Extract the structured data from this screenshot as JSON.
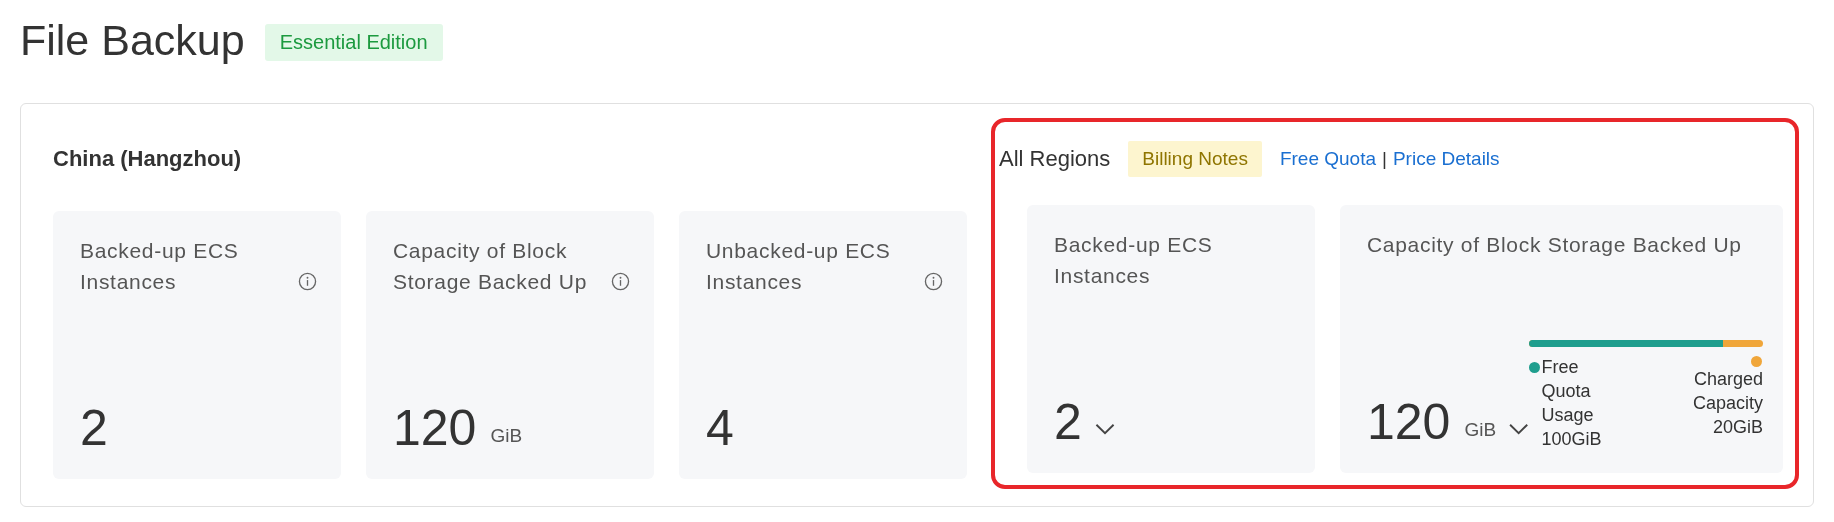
{
  "page": {
    "title": "File Backup",
    "edition_badge": "Essential Edition"
  },
  "regional": {
    "heading": "China (Hangzhou)",
    "cards": [
      {
        "label": "Backed-up ECS Instances",
        "info": true,
        "value": "2",
        "dropdown": false
      },
      {
        "label": "Capacity of Block Storage Backed Up",
        "info": true,
        "value": "120",
        "unit": "GiB",
        "dropdown": false
      },
      {
        "label": "Unbacked-up ECS Instances",
        "info": true,
        "value": "4",
        "dropdown": false
      }
    ]
  },
  "all_regions": {
    "highlighted": true,
    "heading": "All Regions",
    "billing_badge": "Billing Notes",
    "links": [
      "Free Quota",
      "Price Details"
    ],
    "separator": "|",
    "cards": [
      {
        "label": "Backed-up ECS Instances",
        "info": false,
        "value": "2",
        "dropdown": true
      },
      {
        "label": "Capacity of Block Storage Backed Up",
        "info": false,
        "value": "120",
        "unit": "GiB",
        "dropdown": true,
        "usage": {
          "level": 0.83,
          "legend": [
            {
              "label": "Free Quota Usage 100GiB",
              "color": "#1f9e8e"
            },
            {
              "label": "Charged Capacity 20GiB",
              "color": "#f0a63a"
            }
          ]
        }
      }
    ]
  }
}
